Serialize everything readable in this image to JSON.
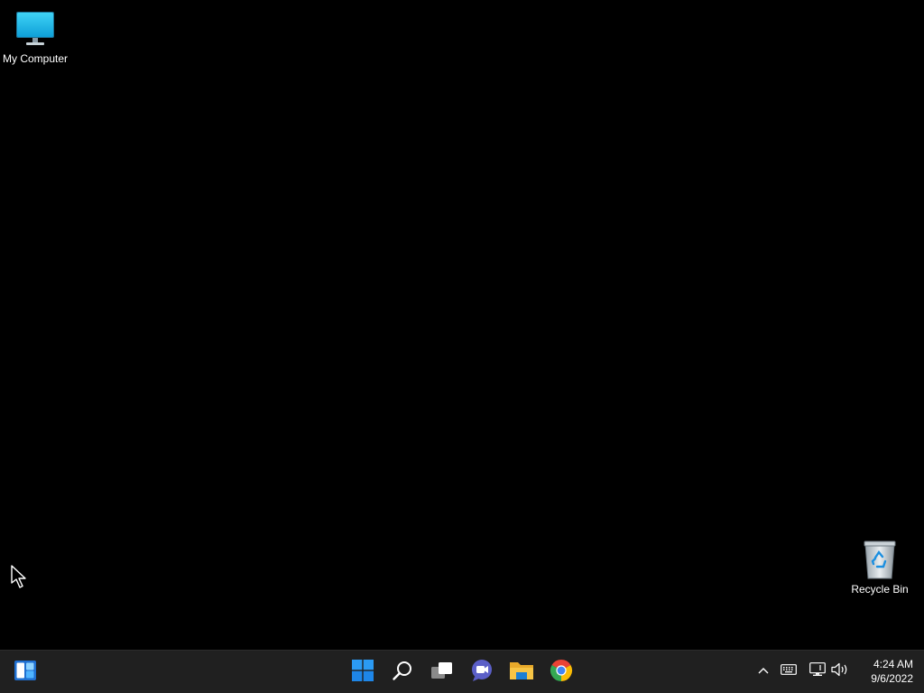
{
  "desktop": {
    "background": "#000000",
    "icons": [
      {
        "label": "My Computer",
        "icon": "monitor-icon"
      },
      {
        "label": "Recycle Bin",
        "icon": "recycle-bin-icon"
      }
    ]
  },
  "taskbar": {
    "background": "#202020",
    "left": [
      {
        "name": "widgets-button",
        "icon": "widgets-icon"
      }
    ],
    "center": [
      {
        "name": "start-button",
        "icon": "windows-logo-icon"
      },
      {
        "name": "search-button",
        "icon": "search-icon"
      },
      {
        "name": "task-view-button",
        "icon": "task-view-icon"
      },
      {
        "name": "teams-chat-button",
        "icon": "teams-chat-icon"
      },
      {
        "name": "file-explorer-button",
        "icon": "folder-icon"
      },
      {
        "name": "chrome-button",
        "icon": "chrome-icon"
      }
    ],
    "tray": [
      {
        "name": "show-hidden-icons-button",
        "icon": "chevron-up-icon"
      },
      {
        "name": "keyboard-button",
        "icon": "keyboard-icon"
      },
      {
        "name": "network-button",
        "icon": "network-icon"
      },
      {
        "name": "volume-button",
        "icon": "speaker-icon"
      }
    ],
    "clock": {
      "time": "4:24 AM",
      "date": "9/6/2022"
    }
  },
  "colors": {
    "windows_blue": "#1e90ff",
    "chat_purple": "#5b5fc7",
    "folder_yellow": "#f6c445"
  }
}
